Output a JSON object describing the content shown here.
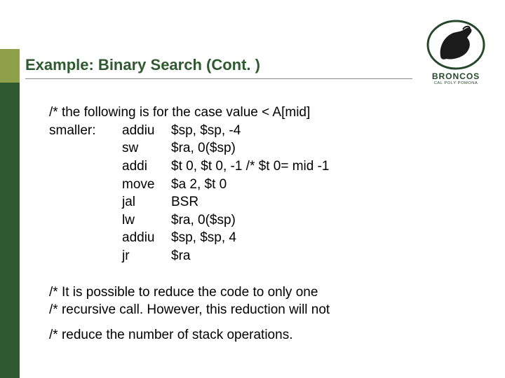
{
  "brand": {
    "wordmark": "BRONCOS",
    "subline": "CAL POLY POMONA",
    "logo_icon_name": "bronco-horse-icon",
    "colors": {
      "dark_green": "#2f5a2f",
      "olive": "#8fa04a"
    }
  },
  "title": "Example: Binary Search (Cont. )",
  "code": {
    "comment": "/* the following is for the case value < A[mid]",
    "label": "smaller:",
    "rows": [
      {
        "op": "addiu",
        "args": "$sp, $sp, -4"
      },
      {
        "op": "sw",
        "args": "$ra, 0($sp)"
      },
      {
        "op": "addi",
        "args": "$t 0, $t 0, -1 /* $t 0= mid -1"
      },
      {
        "op": "move",
        "args": "$a 2, $t 0"
      },
      {
        "op": "jal",
        "args": "BSR"
      },
      {
        "op": "lw",
        "args": "$ra, 0($sp)"
      },
      {
        "op": "addiu",
        "args": "$sp, $sp, 4"
      },
      {
        "op": "jr",
        "args": "$ra"
      }
    ]
  },
  "notes": [
    "/* It is possible to reduce the code to only one",
    "/* recursive call. However,  this reduction will not",
    "/* reduce the number of stack operations."
  ]
}
